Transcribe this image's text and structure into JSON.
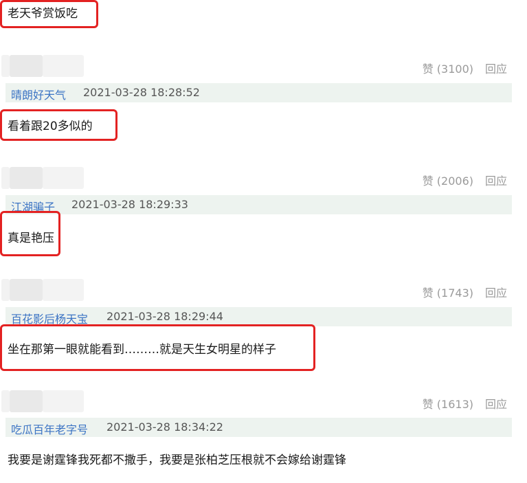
{
  "top_comment": {
    "text": "老天爷赏饭吃"
  },
  "comments": [
    {
      "likes_label": "赞 (3100)",
      "reply_label": "回应",
      "username": "晴朗好天气",
      "timestamp": "2021-03-28 18:28:52",
      "text": "看着跟20多似的"
    },
    {
      "likes_label": "赞 (2006)",
      "reply_label": "回应",
      "username": "江湖骗子",
      "timestamp": "2021-03-28 18:29:33",
      "text": "真是艳压"
    },
    {
      "likes_label": "赞 (1743)",
      "reply_label": "回应",
      "username": "百花影后杨天宝",
      "timestamp": "2021-03-28 18:29:44",
      "text": "坐在那第一眼就能看到………就是天生女明星的样子"
    },
    {
      "likes_label": "赞 (1613)",
      "reply_label": "回应",
      "username": "吃瓜百年老字号",
      "timestamp": "2021-03-28 18:34:22",
      "text": "我要是谢霆锋我死都不撒手，我要是张柏芝压根就不会嫁给谢霆锋"
    }
  ],
  "colors": {
    "highlight_box": "#e32222",
    "username": "#3c74c4",
    "meta_bar_bg": "#edf3ef",
    "muted_text": "#9a9a9a"
  }
}
